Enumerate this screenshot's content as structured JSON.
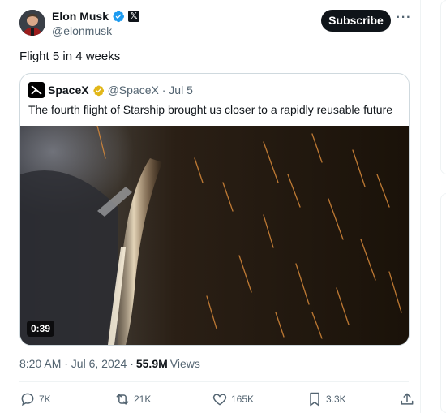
{
  "author": {
    "display_name": "Elon Musk",
    "handle": "@elonmusk",
    "verified_color": "#1d9bf0"
  },
  "header": {
    "subscribe_label": "Subscribe",
    "more_icon": "more-horizontal-icon"
  },
  "tweet": {
    "text": "Flight 5 in 4 weeks",
    "time": "8:20 AM · Jul 6, 2024 ·",
    "views_count": "55.9M",
    "views_label": "Views"
  },
  "quote": {
    "name": "SpaceX",
    "handle_date": "@SpaceX · Jul 5",
    "text": "The fourth flight of Starship brought us closer to a rapidly reusable future",
    "video_duration": "0:39",
    "verified_color": "#e2b719"
  },
  "actions": {
    "replies": "7K",
    "reposts": "21K",
    "likes": "165K",
    "bookmarks": "3.3K"
  }
}
